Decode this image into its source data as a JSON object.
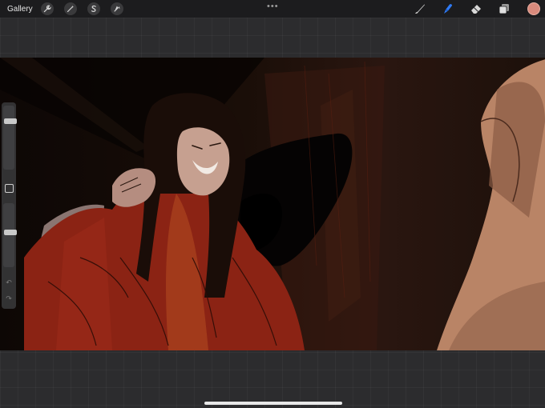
{
  "topbar": {
    "gallery_label": "Gallery",
    "left_tools": [
      "wrench-icon",
      "magic-wand-icon",
      "selection-s-icon",
      "transform-arrow-icon"
    ],
    "more_label": "•••",
    "right_tools": [
      "brush-icon",
      "smudge-icon",
      "eraser-icon",
      "layers-icon"
    ],
    "active_color": "#d98a7c",
    "active_tool_color": "#2f7bf6"
  },
  "sidebar": {
    "brush_size_level": 0.78,
    "opacity_level": 0.55,
    "undo_glyph": "↶",
    "redo_glyph": "↷"
  }
}
